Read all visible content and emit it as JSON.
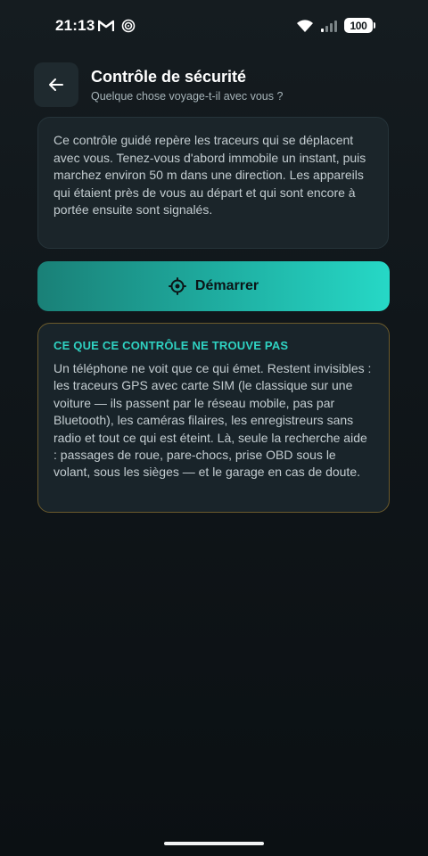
{
  "status_bar": {
    "time": "21:13",
    "battery": "100"
  },
  "header": {
    "title": "Contrôle de sécurité",
    "subtitle": "Quelque chose voyage-t-il avec vous ?"
  },
  "info_card": {
    "text": "Ce contrôle guidé repère les traceurs qui se déplacent avec vous. Tenez-vous d'abord immobile un instant, puis marchez environ 50 m dans une direction. Les appareils qui étaient près de vous au départ et qui sont encore à portée ensuite sont signalés."
  },
  "start_button": {
    "label": "Démarrer"
  },
  "warning_card": {
    "title": "CE QUE CE CONTRÔLE NE TROUVE PAS",
    "body": "Un téléphone ne voit que ce qui émet. Restent invisibles : les traceurs GPS avec carte SIM (le classique sur une voiture — ils passent par le réseau mobile, pas par Bluetooth), les caméras filaires, les enregistreurs sans radio et tout ce qui est éteint. Là, seule la recherche aide : passages de roue, pare-chocs, prise OBD sous le volant, sous les sièges — et le garage en cas de doute."
  },
  "colors": {
    "accent": "#26d8c6",
    "accent_dark": "#1a8077",
    "warning_border": "#6b5a2c",
    "background": "#10161a"
  }
}
